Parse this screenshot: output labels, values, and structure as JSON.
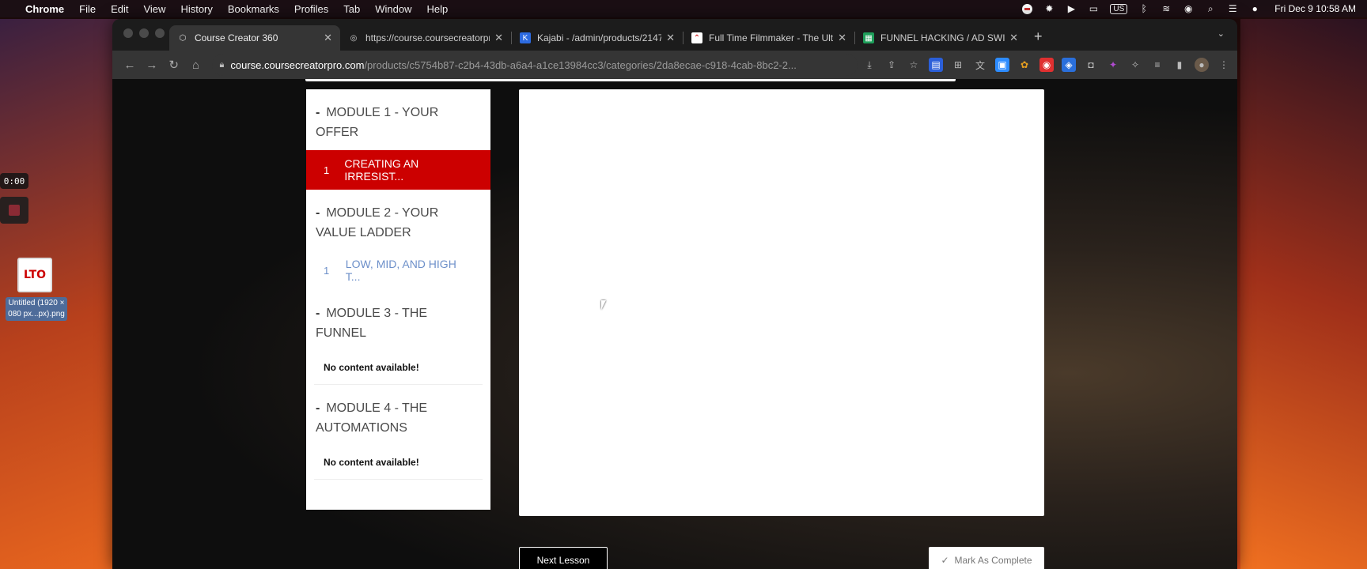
{
  "menubar": {
    "app": "Chrome",
    "items": [
      "File",
      "Edit",
      "View",
      "History",
      "Bookmarks",
      "Profiles",
      "Tab",
      "Window",
      "Help"
    ],
    "lang": "US",
    "clock": "Fri Dec 9  10:58 AM"
  },
  "recorder": {
    "time": "0:00"
  },
  "desktop_file": {
    "logo": "LTO",
    "label_line1": "Untitled (1920 ×",
    "label_line2": "080 px...px).png"
  },
  "browser": {
    "tabs": [
      {
        "title": "Course Creator 360",
        "icon": "course-creator-icon",
        "active": true
      },
      {
        "title": "https://course.coursecreatorpro",
        "icon": "globe-icon",
        "active": false
      },
      {
        "title": "Kajabi - /admin/products/2147",
        "icon": "kajabi-icon",
        "active": false
      },
      {
        "title": "Full Time Filmmaker - The Ulti",
        "icon": "filmmaker-icon",
        "active": false
      },
      {
        "title": "FUNNEL HACKING / AD SWIPE",
        "icon": "sheets-icon",
        "active": false
      }
    ],
    "url_host": "course.coursecreatorpro.com",
    "url_path": "/products/c5754b87-c2b4-43db-a6a4-a1ce13984cc3/categories/2da8ecae-c918-4cab-8bc2-2..."
  },
  "course": {
    "modules": [
      {
        "title": "MODULE 1 - YOUR OFFER",
        "lessons": [
          {
            "num": "1",
            "title": "CREATING AN IRRESIST..."
          }
        ]
      },
      {
        "title": "MODULE 2 - YOUR VALUE LADDER",
        "lessons": [
          {
            "num": "1",
            "title": "LOW, MID, AND HIGH T..."
          }
        ]
      },
      {
        "title": "MODULE 3 - THE FUNNEL",
        "empty_text": "No content available!"
      },
      {
        "title": "MODULE 4 - THE AUTOMATIONS",
        "empty_text": "No content available!"
      }
    ],
    "next_label": "Next Lesson",
    "complete_label": "Mark As Complete",
    "dash": "-"
  },
  "colors": {
    "active_lesson": "#cc0000",
    "lesson_link": "#6c8fc9"
  }
}
